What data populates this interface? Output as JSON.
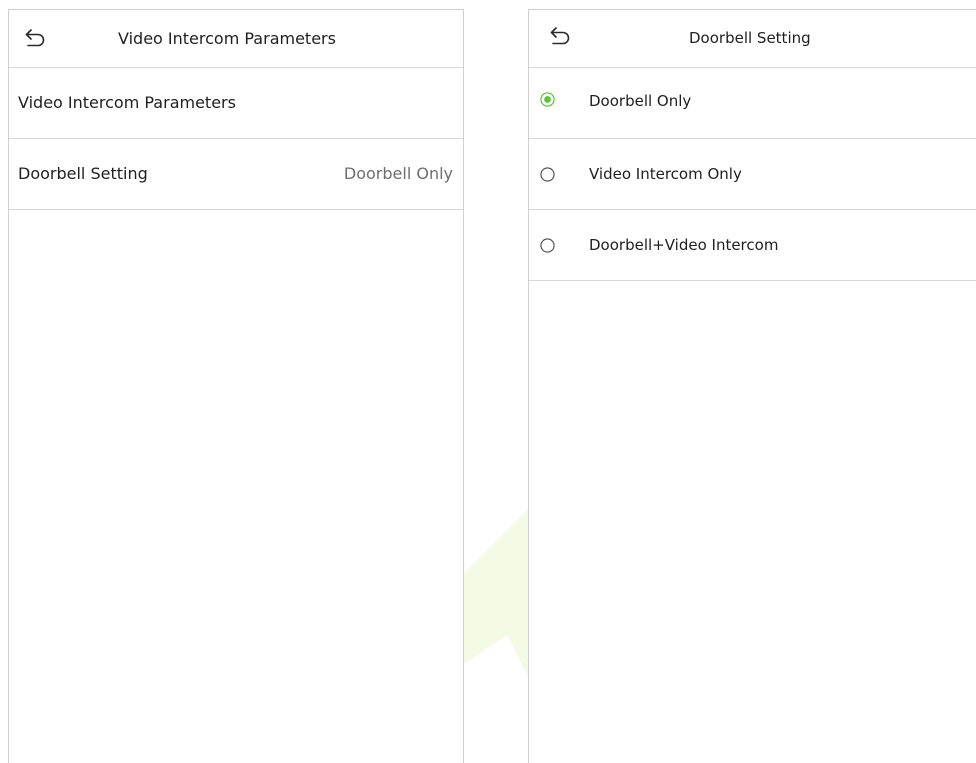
{
  "left_screen": {
    "title": "Video Intercom Parameters",
    "back_icon": "back-arrow-icon",
    "rows": [
      {
        "label": "Video Intercom Parameters",
        "value": ""
      },
      {
        "label": "Doorbell Setting",
        "value": "Doorbell Only"
      }
    ]
  },
  "right_screen": {
    "title": "Doorbell Setting",
    "back_icon": "back-arrow-icon",
    "options": [
      {
        "label": "Doorbell Only",
        "selected": true
      },
      {
        "label": "Video Intercom Only",
        "selected": false
      },
      {
        "label": "Doorbell+Video Intercom",
        "selected": false
      }
    ]
  },
  "colors": {
    "accent": "#5cc33c",
    "divider": "#d6d6d6",
    "value_text": "#6e6e6e",
    "watermark": "#f3fbe4"
  }
}
